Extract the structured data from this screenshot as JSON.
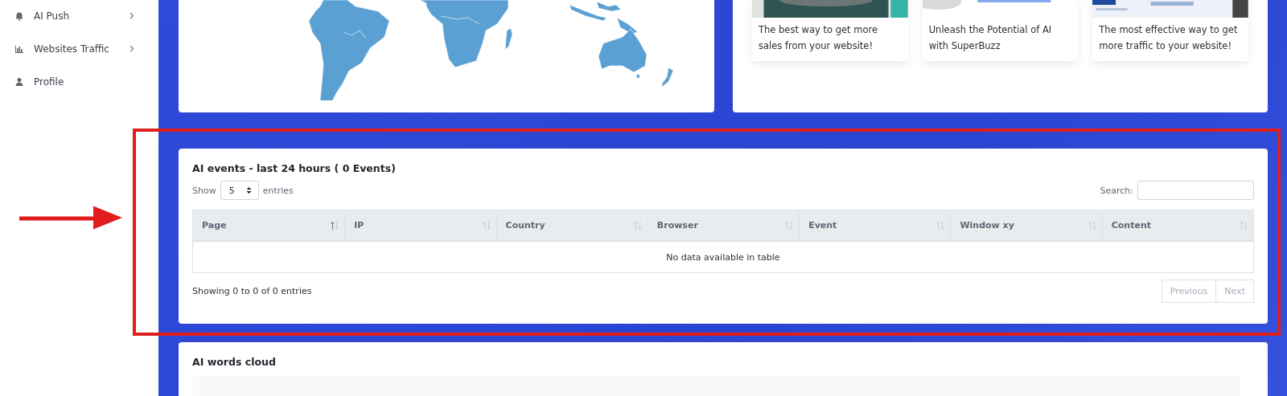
{
  "sidebar": {
    "items": [
      {
        "label": "AI Push",
        "expandable": true
      },
      {
        "label": "Websites Traffic",
        "expandable": true
      },
      {
        "label": "Profile",
        "expandable": false
      }
    ]
  },
  "promos": [
    {
      "text": "The best way to get more sales from your website!"
    },
    {
      "text": "Unleash the Potential of AI with SuperBuzz"
    },
    {
      "text": "The most effective way to get more traffic to your website!"
    }
  ],
  "events": {
    "title": "AI events - last 24 hours ( 0 Events)",
    "show_label": "Show",
    "page_size": "5",
    "entries_label": "entries",
    "search_label": "Search:",
    "columns": [
      {
        "label": "Page",
        "sorted": true
      },
      {
        "label": "IP",
        "sorted": false
      },
      {
        "label": "Country",
        "sorted": false
      },
      {
        "label": "Browser",
        "sorted": false
      },
      {
        "label": "Event",
        "sorted": false
      },
      {
        "label": "Window xy",
        "sorted": false
      },
      {
        "label": "Content",
        "sorted": false
      }
    ],
    "empty_message": "No data available in table",
    "info": "Showing 0 to 0 of 0 entries",
    "pagination": [
      {
        "label": "Previous",
        "disabled": true
      },
      {
        "label": "Next",
        "disabled": true
      }
    ]
  },
  "words_cloud": {
    "title": "AI words cloud"
  }
}
